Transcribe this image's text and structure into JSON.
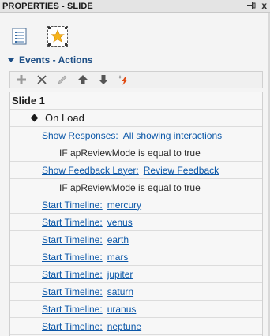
{
  "panel": {
    "title": "PROPERTIES - SLIDE",
    "pin_icon": "pin-icon",
    "close_glyph": "x"
  },
  "tabs": [
    {
      "icon": "list-properties-icon"
    },
    {
      "icon": "slide-star-icon"
    }
  ],
  "section": {
    "label": "Events - Actions"
  },
  "toolbar": {
    "icons": [
      "add-icon",
      "delete-icon",
      "edit-icon",
      "move-up-icon",
      "move-down-icon",
      "sparkle-lightning-icon"
    ]
  },
  "tree": {
    "slide_label": "Slide 1",
    "event_label": "On Load",
    "actions": [
      {
        "type": "action",
        "label": "Show Responses:",
        "value": "All showing interactions"
      },
      {
        "type": "condition",
        "text": "IF apReviewMode is equal to true"
      },
      {
        "type": "action",
        "label": "Show Feedback Layer:",
        "value": "Review Feedback"
      },
      {
        "type": "condition",
        "text": "IF apReviewMode is equal to true"
      },
      {
        "type": "action",
        "label": "Start Timeline:",
        "value": "mercury"
      },
      {
        "type": "action",
        "label": "Start Timeline:",
        "value": "venus"
      },
      {
        "type": "action",
        "label": "Start Timeline:",
        "value": "earth"
      },
      {
        "type": "action",
        "label": "Start Timeline:",
        "value": "mars"
      },
      {
        "type": "action",
        "label": "Start Timeline:",
        "value": "jupiter"
      },
      {
        "type": "action",
        "label": "Start Timeline:",
        "value": "saturn"
      },
      {
        "type": "action",
        "label": "Start Timeline:",
        "value": "uranus"
      },
      {
        "type": "action",
        "label": "Start Timeline:",
        "value": "neptune"
      }
    ]
  },
  "colors": {
    "link": "#0b57a8",
    "section_header": "#1e4f86",
    "active_icon": "#e04a12"
  }
}
